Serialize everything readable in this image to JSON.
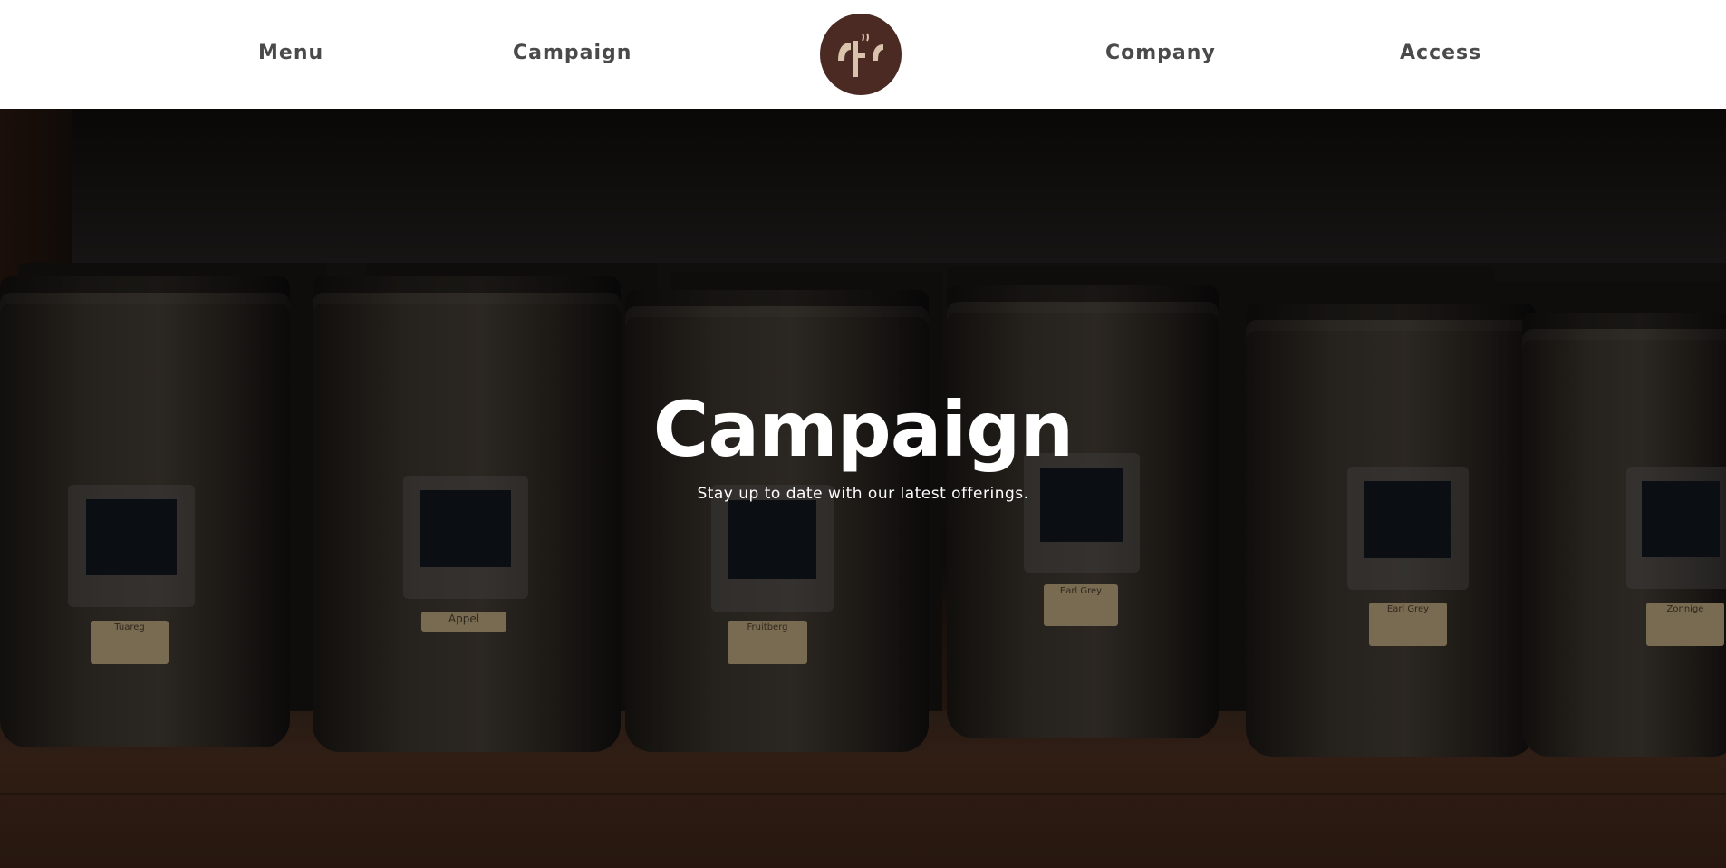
{
  "header": {
    "nav": {
      "menu": "Menu",
      "campaign": "Campaign",
      "company": "Company",
      "access": "Access"
    },
    "logo_icon": "coffee-brand-logo",
    "colors": {
      "logo_bg": "#4b2a24",
      "nav_text": "#4a4a4a"
    }
  },
  "hero": {
    "title": "Campaign",
    "subtitle": "Stay up to date with our latest offerings.",
    "bag_tags": [
      "Tuareg",
      "Appel",
      "Fruitberg",
      "Earl Grey",
      "Earl Grey",
      "Zonnige"
    ]
  }
}
